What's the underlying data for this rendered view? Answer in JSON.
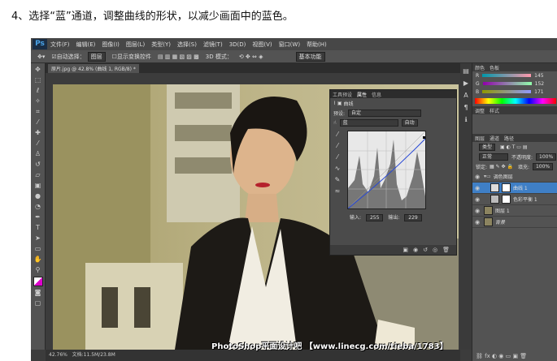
{
  "caption": "4、选择“蓝”通道，调整曲线的形状，以减少画面中的蓝色。",
  "app": {
    "logo": "Ps"
  },
  "menu": [
    "文件(F)",
    "编辑(E)",
    "图像(I)",
    "图层(L)",
    "类型(Y)",
    "选择(S)",
    "滤镜(T)",
    "3D(D)",
    "视图(V)",
    "窗口(W)",
    "帮助(H)"
  ],
  "options": {
    "auto_select": "自动选择：",
    "select_value": "图层",
    "show_transform": "显示变换控件",
    "mode_3d": "3D 模式：",
    "workspace": "基本功能"
  },
  "document": {
    "tab": "原片.jpg @ 42.8% (曲线 1, RGB/8) *"
  },
  "status": {
    "zoom": "42.76%",
    "doc": "文档:11.5M/23.8M"
  },
  "watermark": "PhotoShop平面设计吧 【www.linecg.com/tieba/1783】",
  "curves": {
    "tabs": [
      "工具预设",
      "属性",
      "信息"
    ],
    "title": "曲线",
    "preset_label": "预设:",
    "preset_value": "自定",
    "channel": "蓝",
    "auto": "自动",
    "input_label": "输入:",
    "input_value": "255",
    "output_label": "输出:",
    "output_value": "229"
  },
  "colorpanel": {
    "tabs": [
      "颜色",
      "色板"
    ],
    "r": "145",
    "g": "152",
    "b": "171"
  },
  "adjust_tabs": [
    "调整",
    "样式"
  ],
  "layers": {
    "tabs": [
      "图层",
      "通道",
      "路径"
    ],
    "kind": "类型",
    "blend": "正常",
    "opacity_label": "不透明度:",
    "opacity": "100%",
    "lock": "锁定:",
    "fill_label": "填充:",
    "fill": "100%",
    "items": [
      {
        "name": "调色图层"
      },
      {
        "name": "曲线 1"
      },
      {
        "name": "色彩平衡 1"
      },
      {
        "name": "图层 1"
      },
      {
        "name": "背景"
      }
    ]
  }
}
